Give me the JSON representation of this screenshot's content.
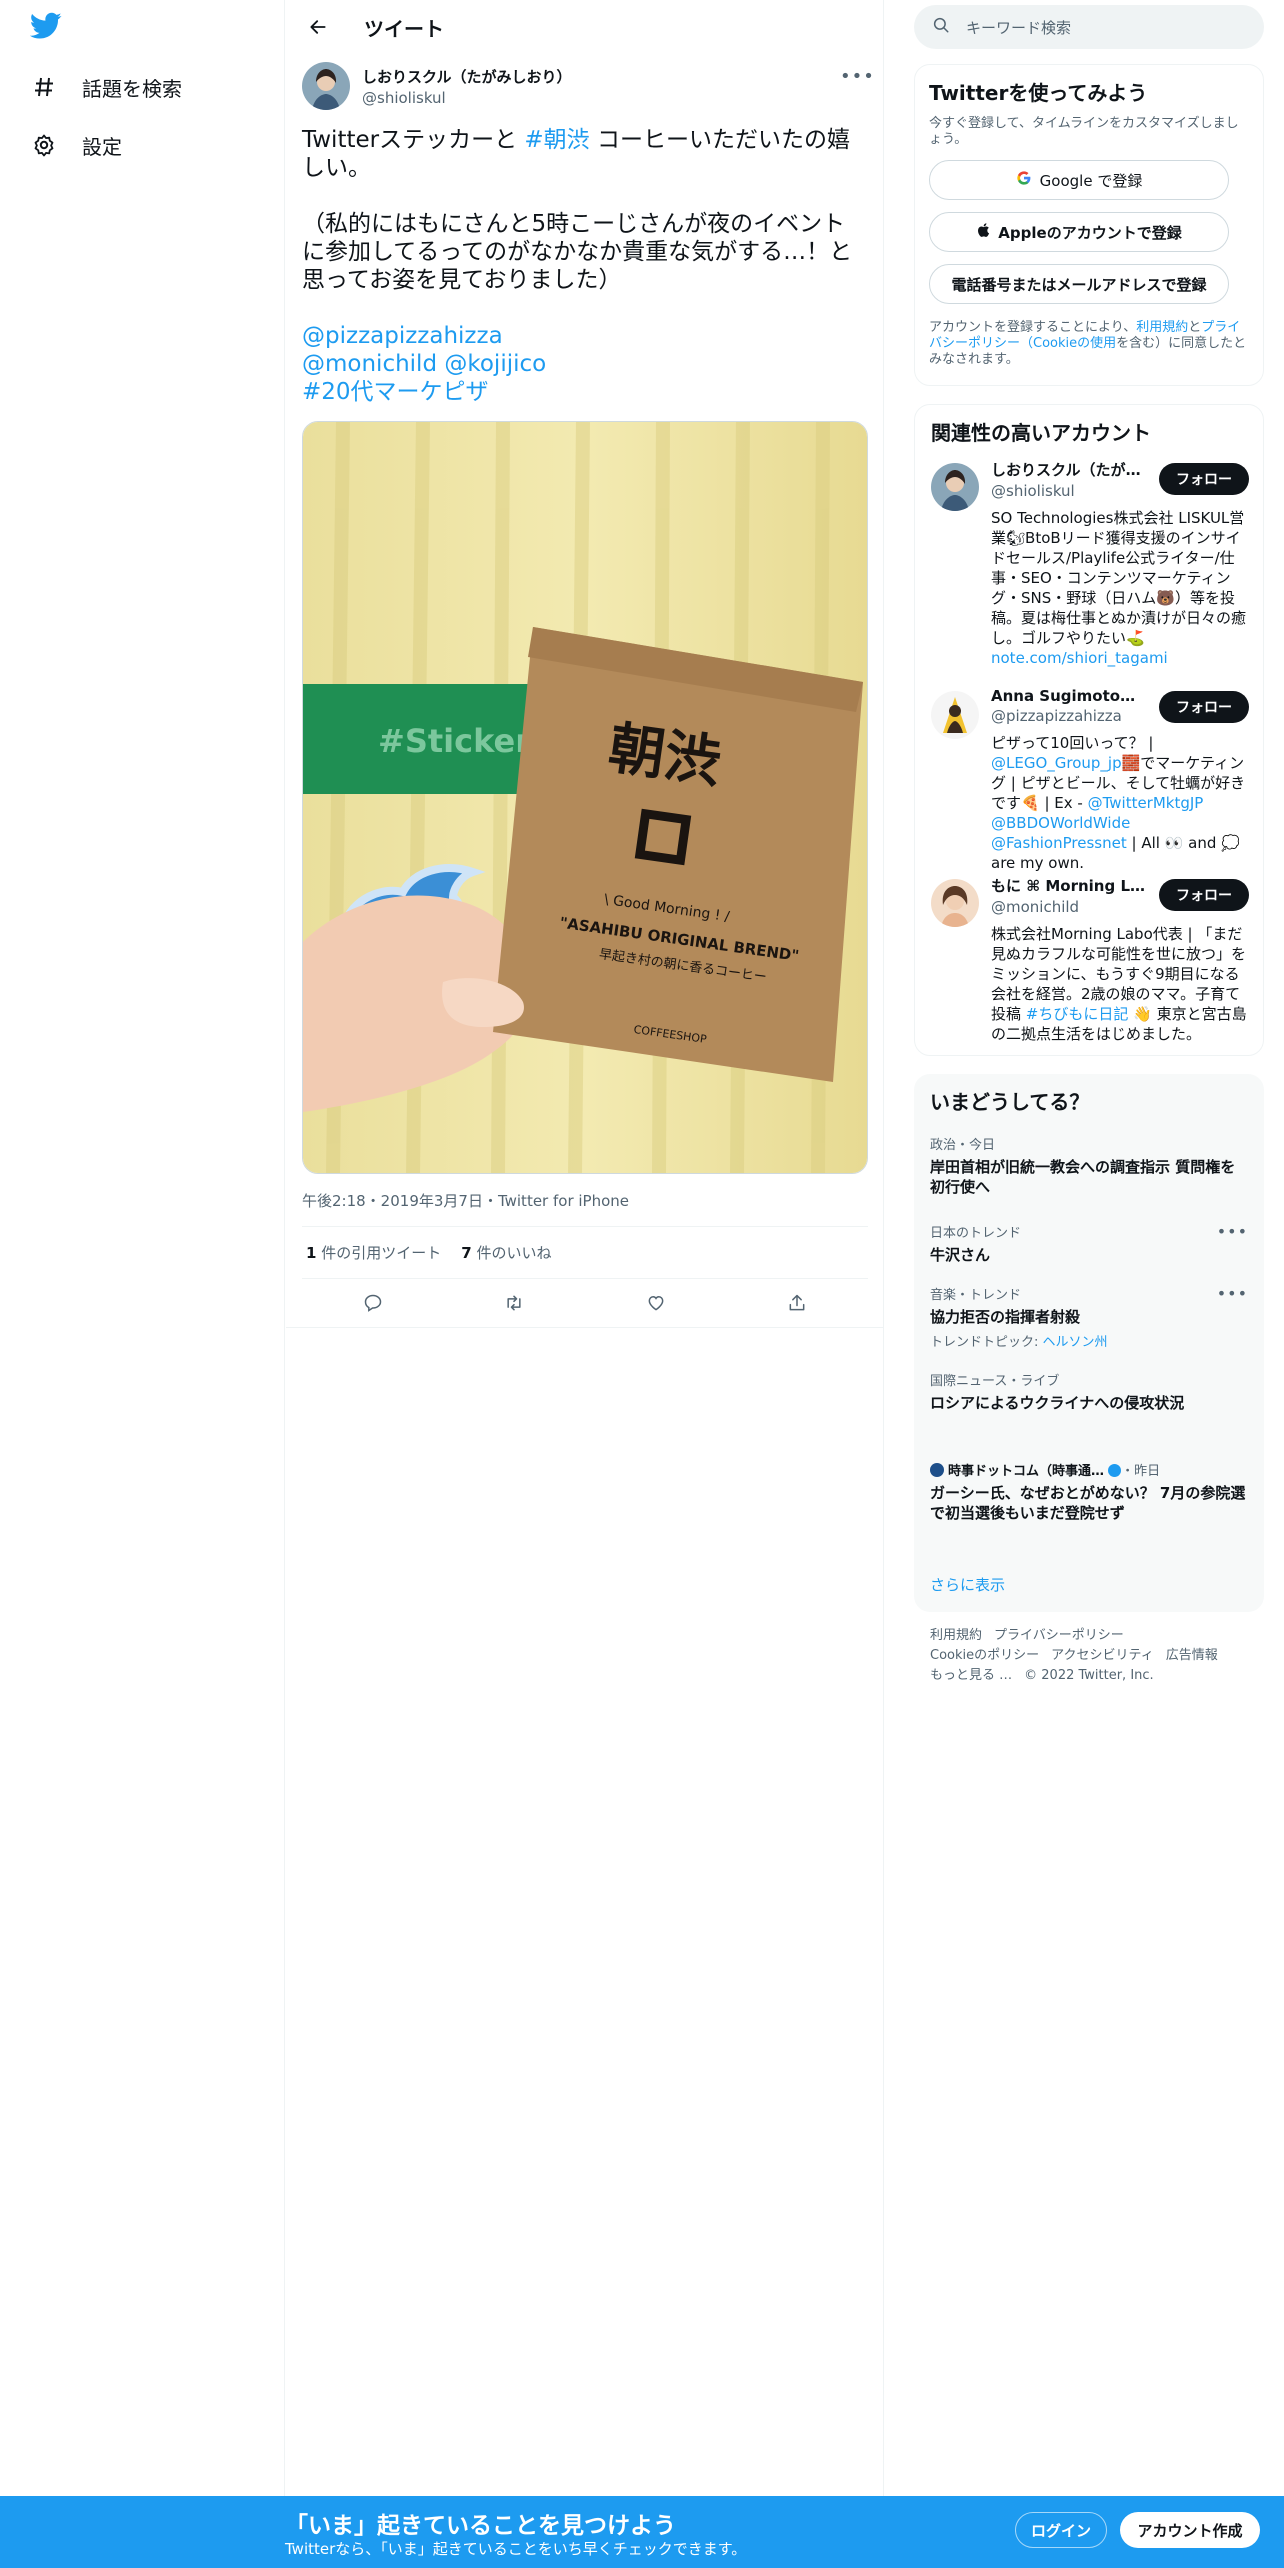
{
  "colors": {
    "accent": "#1d9bf0",
    "text": "#0f1419",
    "muted": "#536471",
    "banner": "#1d9bf0"
  },
  "nav": {
    "logo_icon": "twitter-bird-icon",
    "items": [
      {
        "label": "話題を検索",
        "icon": "hashtag-icon"
      },
      {
        "label": "設定",
        "icon": "gear-icon"
      }
    ]
  },
  "header": {
    "title": "ツイート",
    "back_icon": "arrow-left-icon"
  },
  "tweet": {
    "author_name": "しおりスクル（たがみしおり）",
    "author_handle": "@shioliskul",
    "text_part1": "Twitterステッカーと ",
    "hashtag1": "#朝渋",
    "text_part2": " コーヒーいただいたの嬉しい。",
    "paragraph2": "（私的にはもにさんと5時こーじさんが夜のイベントに参加してるってのがなかなか貴重な気がする…！と思ってお姿を見ておりました）",
    "mention1": "@pizzapizzahizza",
    "mention2": "@monichild",
    "mention3": "@kojijico",
    "hashtag2": "#20代マーケピザ",
    "media_texts": {
      "sticker": "#Sticker",
      "brand": "朝渋",
      "good_morning": "\\ Good Morning ! /",
      "product": "\"ASAHIBU ORIGINAL BREND\"",
      "tagline": "早起き村の朝に香るコーヒー",
      "shop": "COFFEESHOP"
    },
    "timestamp": "午後2:18・2019年3月7日・Twitter for iPhone",
    "quote_count": "1",
    "quote_label": "件の引用ツイート",
    "like_count": "7",
    "like_label": "件のいいね"
  },
  "search": {
    "placeholder": "キーワード検索"
  },
  "signup": {
    "title": "Twitterを使ってみよう",
    "subtitle": "今すぐ登録して、タイムラインをカスタマイズしましょう。",
    "google": "Google で登録",
    "apple": "Appleのアカウントで登録",
    "phone": "電話番号またはメールアドレスで登録",
    "terms_pre": "アカウントを登録することにより、",
    "terms_link1": "利用規約",
    "terms_mid": "と",
    "terms_link2": "プライバシーポリシー（Cookieの使用",
    "terms_post": "を含む）に同意したとみなされます。"
  },
  "related": {
    "title": "関連性の高いアカウント",
    "follow_label": "フォロー",
    "accounts": [
      {
        "name": "しおりスクル（たがみしおり）",
        "handle": "@shioliskul",
        "bio": "SO Technologies株式会社 LISKUL営業🐿BtoBリード獲得支援のインサイドセールス/Playlife公式ライター/仕事・SEO・コンテンツマーケティング・SNS・野球（日ハム🐻）等を投稿。夏は梅仕事とぬか漬けが日々の癒し。ゴルフやりたい⛳",
        "link": "note.com/shiori_tagami"
      },
      {
        "name": "Anna Sugimoto🍫👩🏻‍💼",
        "handle": "@pizzapizzahizza",
        "bio_pre": "ピザって10回いって？ | ",
        "bio_link1": "@LEGO_Group_jp",
        "bio_mid": "🧱でマーケティング | ピザとビール、そして牡蠣が好きです🍕 | Ex - ",
        "bio_link2": "@TwitterMktgJP",
        "bio_link3": "@BBDOWorldWide",
        "bio_link4": "@FashionPressnet",
        "bio_post": "| All 👀 and 💭 are my own."
      },
      {
        "name": "もに ⌘ Morning Labo",
        "handle": "@monichild",
        "bio_pre": "株式会社Morning Labo代表 | 「まだ見ぬカラフルな可能性を世に放つ」をミッションに、もうすぐ9期目になる会社を経営。2歳の娘のママ。子育て投稿 ",
        "bio_link": "#ちびもに日記",
        "bio_post": " 👋 東京と宮古島の二拠点生活をはじめました。"
      }
    ]
  },
  "trends": {
    "title": "いまどうしてる？",
    "items": [
      {
        "context": "政治・今日",
        "title": "岸田首相が旧統一教会への調査指示 質問権を初行使へ"
      },
      {
        "context": "日本のトレンド",
        "title": "牛沢さん"
      },
      {
        "context": "音楽・トレンド",
        "title": "協力拒否の指揮者射殺",
        "related_pre": "トレンドトピック: ",
        "related_link": "ヘルソン州"
      },
      {
        "context": "国際ニュース・ライブ",
        "title": "ロシアによるウクライナへの侵攻状況"
      },
      {
        "context_name": "時事ドットコム（時事通…",
        "context_time": "・昨日",
        "title": "ガーシー氏、なぜおとがめない？ 7月の参院選で初当選後もいまだ登院せず"
      }
    ],
    "show_more": "さらに表示"
  },
  "footer": {
    "links": [
      "利用規約",
      "プライバシーポリシー",
      "Cookieのポリシー",
      "アクセシビリティ",
      "広告情報",
      "もっと見る …"
    ],
    "copyright": "© 2022 Twitter, Inc."
  },
  "banner": {
    "headline": "「いま」起きていることを見つけよう",
    "sub": "Twitterなら、「いま」起きていることをいち早くチェックできます。",
    "login": "ログイン",
    "signup": "アカウント作成"
  }
}
